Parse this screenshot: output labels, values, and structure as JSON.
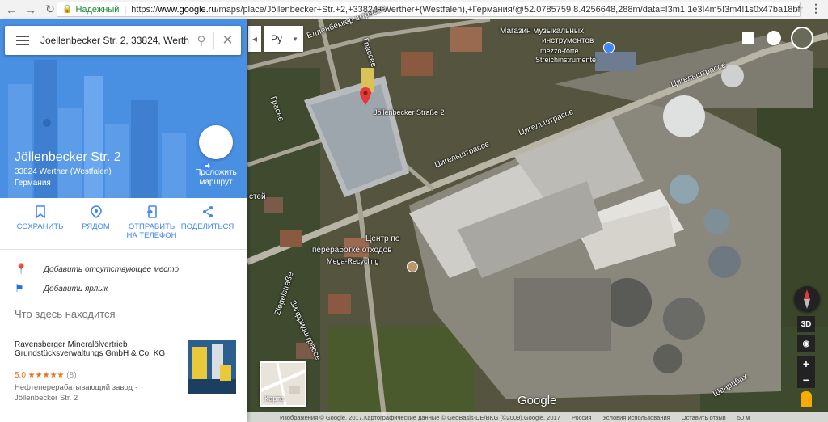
{
  "browser": {
    "secure_label": "Надежный",
    "url_prefix": "https://",
    "url_domain": "www.google.ru",
    "url_rest": "/maps/place/Jöllenbecker+Str.+2,+33824+Werther+(Westfalen),+Германия/@52.0785759,8.4256648,288m/data=!3m1!1e3!4m5!3m4!1s0x47ba18bfabe..."
  },
  "search": {
    "value": "Joellenbecker Str. 2, 33824, Werth"
  },
  "language": {
    "selected": "Ру"
  },
  "place": {
    "title": "Jöllenbecker Str. 2",
    "address": "33824 Werther (Westfalen)",
    "country": "Германия",
    "route_label": "Проложить маршрут"
  },
  "actions": [
    {
      "label": "СОХРАНИТЬ",
      "icon": "bookmark-icon"
    },
    {
      "label": "РЯДОМ",
      "icon": "nearby-icon"
    },
    {
      "label": "ОТПРАВИТЬ НА ТЕЛЕФОН",
      "icon": "send-to-phone-icon"
    },
    {
      "label": "ПОДЕЛИТЬСЯ",
      "icon": "share-icon"
    }
  ],
  "links": {
    "add_place": "Добавить отсутствующее место",
    "add_label": "Добавить ярлык"
  },
  "nearby": {
    "title": "Что здесь находится",
    "business": {
      "name": "Ravensberger Mineralölvertrieb Grundstücksverwaltungs GmbH & Co. KG",
      "rating": "5,0 ★★★★★",
      "count": "(8)",
      "type": "Нефтеперерабатывающий завод ·",
      "address": "Jöllenbecker Str. 2"
    }
  },
  "map": {
    "labels": {
      "street1": "Елленбеккер штрассе",
      "street2": "Грассее",
      "street3": "Цигельштрассе",
      "street4": "Цигельштрассе",
      "street5": "Цигельштрассе",
      "street6": "Ziegelstraße",
      "street7": "Зигфридштрассе",
      "street8": "Шварцбах",
      "street9": "Грасее",
      "street10": "стей",
      "pin_label": "Jöllenbecker Straße 2",
      "recycling_line1": "Центр по",
      "recycling_line2": "переработке отходов",
      "recycling_name": "Mega-Recycling",
      "music_line1": "Магазин музыкальных",
      "music_line2": "инструментов",
      "music_name1": "mezzo-forte",
      "music_name2": "Streichinstrumente"
    },
    "layer_label": "Карта",
    "logo": "Google",
    "controls": {
      "mode_3d": "3D",
      "zoom_in": "+",
      "zoom_out": "−"
    },
    "footer": {
      "imagery": "Изображения © Google, 2017,Картографические данные © GeoBasis-DE/BKG (©2009),Google, 2017",
      "country": "Россия",
      "terms": "Условия использования",
      "feedback": "Оставить отзыв",
      "scale": "50 м"
    }
  }
}
